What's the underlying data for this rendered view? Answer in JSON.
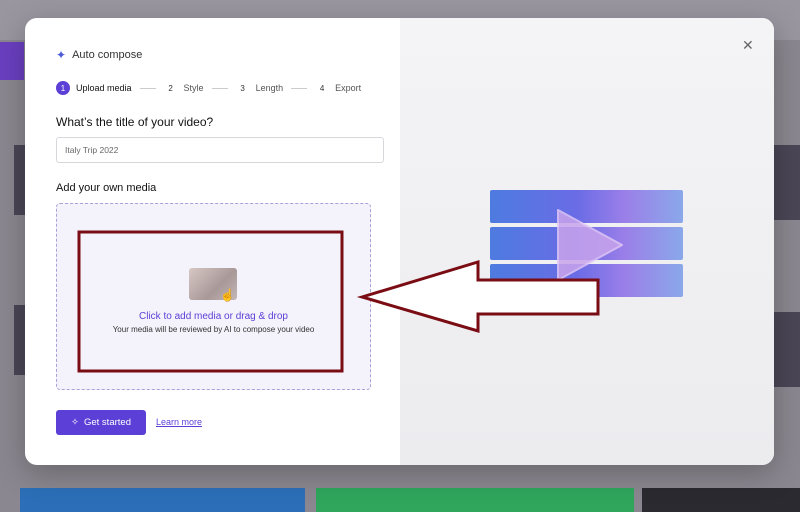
{
  "dialog": {
    "title": "Auto compose",
    "steps": [
      {
        "num": "1",
        "label": "Upload media"
      },
      {
        "num": "2",
        "label": "Style"
      },
      {
        "num": "3",
        "label": "Length"
      },
      {
        "num": "4",
        "label": "Export"
      }
    ],
    "video_title_question": "What’s the title of your video?",
    "video_title_value": "Italy Trip 2022",
    "media_heading": "Add your own media",
    "dropzone_primary": "Click to add media or drag & drop",
    "dropzone_secondary": "Your media will be reviewed by AI to compose your video",
    "get_started_label": "Get started",
    "learn_more_label": "Learn more",
    "close_icon": "close-icon"
  },
  "colors": {
    "accent": "#5b3fd6",
    "annotation": "#7a0c14"
  }
}
